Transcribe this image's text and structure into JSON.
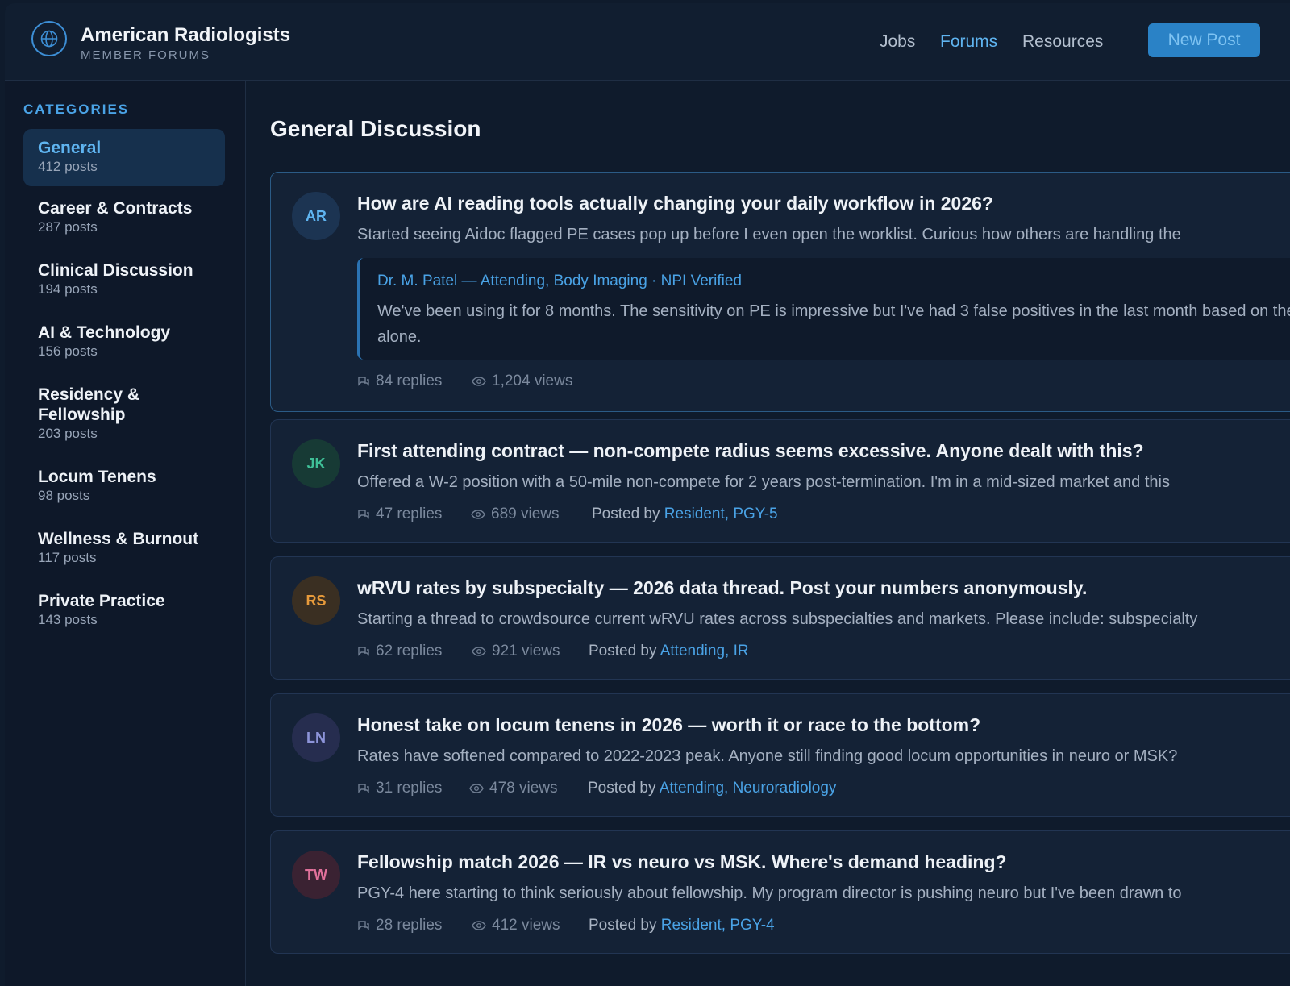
{
  "header": {
    "brand_title": "American Radiologists",
    "brand_subtitle": "MEMBER FORUMS",
    "nav": [
      {
        "label": "Jobs",
        "active": false
      },
      {
        "label": "Forums",
        "active": true
      },
      {
        "label": "Resources",
        "active": false
      }
    ],
    "new_post_label": "New Post",
    "logo_icon": "globe-icon"
  },
  "sidebar": {
    "heading": "CATEGORIES",
    "items": [
      {
        "name": "General",
        "count": "412 posts",
        "active": true
      },
      {
        "name": "Career & Contracts",
        "count": "287 posts"
      },
      {
        "name": "Clinical Discussion",
        "count": "194 posts"
      },
      {
        "name": "AI & Technology",
        "count": "156 posts"
      },
      {
        "name": "Residency & Fellowship",
        "count": "203 posts"
      },
      {
        "name": "Locum Tenens",
        "count": "98 posts"
      },
      {
        "name": "Wellness & Burnout",
        "count": "117 posts"
      },
      {
        "name": "Private Practice",
        "count": "143 posts"
      }
    ]
  },
  "main": {
    "title": "General Discussion",
    "posts": [
      {
        "initials": "AR",
        "title": "How are AI reading tools actually changing your daily workflow in 2026?",
        "excerpt": "Started seeing Aidoc flagged PE cases pop up before I even open the worklist. Curious how others are handling the",
        "reply": {
          "author": "Dr. M. Patel — Attending, Body Imaging · NPI Verified",
          "text": "We've been using it for 8 months. The sensitivity on PE is impressive but I've had 3 false positives in the last month based on the flag alone."
        },
        "replies": "84 replies",
        "views": "1,204 views"
      },
      {
        "initials": "JK",
        "title": "First attending contract — non-compete radius seems excessive. Anyone dealt with this?",
        "excerpt": "Offered a W-2 position with a 50-mile non-compete for 2 years post-termination. I'm in a mid-sized market and this",
        "replies": "47 replies",
        "views": "689 views",
        "posted_by_label": "Posted by",
        "posted_by": "Resident, PGY-5"
      },
      {
        "initials": "RS",
        "title": "wRVU rates by subspecialty — 2026 data thread. Post your numbers anonymously.",
        "excerpt": "Starting a thread to crowdsource current wRVU rates across subspecialties and markets. Please include: subspecialty",
        "replies": "62 replies",
        "views": "921 views",
        "posted_by_label": "Posted by",
        "posted_by": "Attending, IR"
      },
      {
        "initials": "LN",
        "title": "Honest take on locum tenens in 2026 — worth it or race to the bottom?",
        "excerpt": "Rates have softened compared to 2022-2023 peak. Anyone still finding good locum opportunities in neuro or MSK?",
        "replies": "31 replies",
        "views": "478 views",
        "posted_by_label": "Posted by",
        "posted_by": "Attending, Neuroradiology"
      },
      {
        "initials": "TW",
        "title": "Fellowship match 2026 — IR vs neuro vs MSK. Where's demand heading?",
        "excerpt": "PGY-4 here starting to think seriously about fellowship. My program director is pushing neuro but I've been drawn to",
        "replies": "28 replies",
        "views": "412 views",
        "posted_by_label": "Posted by",
        "posted_by": "Resident, PGY-4"
      }
    ]
  },
  "colors": {
    "accent": "#4aa3e6",
    "button": "#2a82c6",
    "background": "#0f1b2c"
  }
}
